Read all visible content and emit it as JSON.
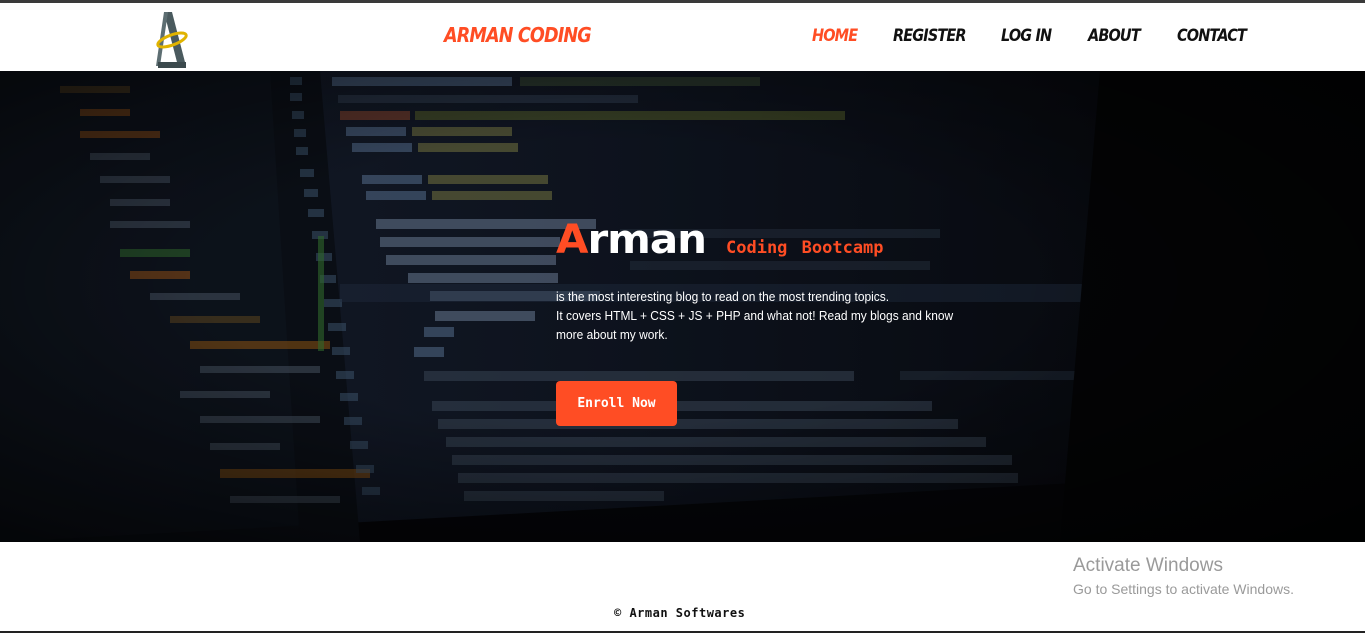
{
  "header": {
    "brand": "ARMAN CODING",
    "nav": [
      {
        "label": "HOME",
        "active": true
      },
      {
        "label": "REGISTER",
        "active": false
      },
      {
        "label": "LOG IN",
        "active": false
      },
      {
        "label": "ABOUT",
        "active": false
      },
      {
        "label": "CONTACT",
        "active": false
      }
    ]
  },
  "hero": {
    "title_first": "A",
    "title_rest": "rman",
    "subtitle": "Coding Bootcamp",
    "desc_line1": "is the most interesting blog to read on the most trending topics.",
    "desc_line2": "It covers HTML + CSS + JS + PHP and what not! Read my blogs and know",
    "desc_line3": "more about my work.",
    "button": "Enroll Now"
  },
  "footer": {
    "copyright": "© Arman Softwares"
  },
  "watermark": {
    "title": "Activate Windows",
    "subtitle": "Go to Settings to activate Windows."
  },
  "colors": {
    "accent": "#ff4d24",
    "nav_text": "#111111",
    "hero_bg": "#0a0c12"
  },
  "icons": {
    "logo": "arman-a-logo-icon"
  }
}
